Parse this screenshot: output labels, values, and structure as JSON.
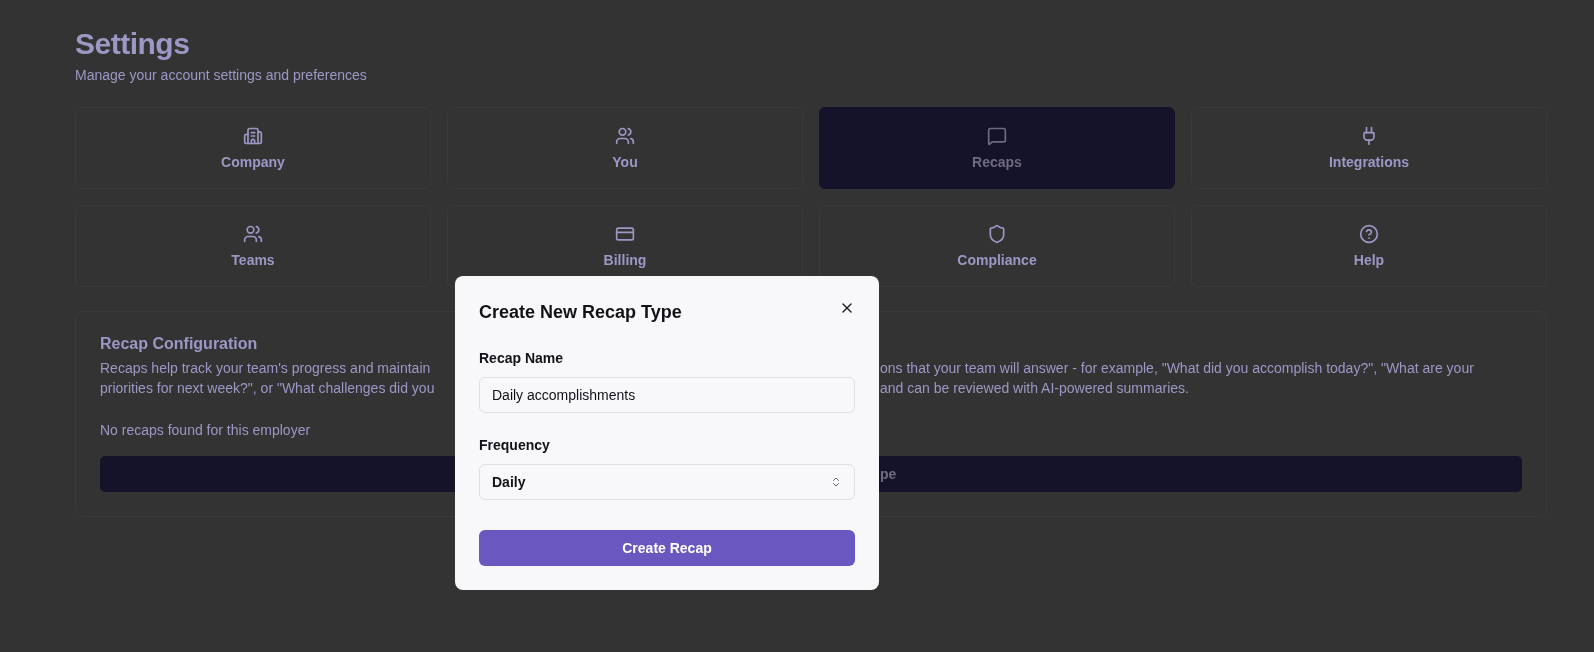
{
  "page": {
    "title": "Settings",
    "subtitle": "Manage your account settings and preferences"
  },
  "tabs": [
    {
      "label": "Company",
      "selected": false
    },
    {
      "label": "You",
      "selected": false
    },
    {
      "label": "Recaps",
      "selected": true
    },
    {
      "label": "Integrations",
      "selected": false
    },
    {
      "label": "Teams",
      "selected": false
    },
    {
      "label": "Billing",
      "selected": false
    },
    {
      "label": "Compliance",
      "selected": false
    },
    {
      "label": "Help",
      "selected": false
    }
  ],
  "recap_configuration": {
    "title": "Recap Configuration",
    "description_left": [
      "Recaps help track your team's progress and maintain",
      "priorities for next week?\", or \"What challenges did you"
    ],
    "description_right": [
      "ons that your team will answer - for example, \"What did you accomplish today?\", \"What are your",
      "and can be reviewed with AI-powered summaries."
    ],
    "empty_message": "No recaps found for this employer",
    "button_label": "pe"
  },
  "dialog": {
    "title": "Create New Recap Type",
    "fields": [
      {
        "kind": "text",
        "label": "Recap Name",
        "value": "Daily accomplishments"
      },
      {
        "kind": "select",
        "label": "Frequency",
        "value": "Daily"
      }
    ],
    "submit": "Create Recap"
  }
}
